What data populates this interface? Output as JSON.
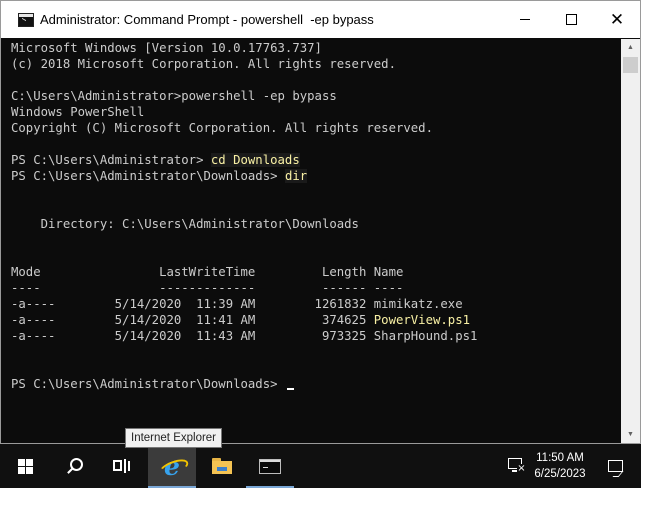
{
  "window": {
    "title": "Administrator: Command Prompt - powershell  -ep bypass",
    "minimize_label": "Minimize",
    "maximize_label": "Maximize",
    "close_label": "Close"
  },
  "console": {
    "lines": [
      {
        "text": "Microsoft Windows [Version 10.0.17763.737]"
      },
      {
        "text": "(c) 2018 Microsoft Corporation. All rights reserved."
      },
      {
        "text": ""
      },
      {
        "text": "C:\\Users\\Administrator>powershell -ep bypass"
      },
      {
        "text": "Windows PowerShell"
      },
      {
        "text": "Copyright (C) Microsoft Corporation. All rights reserved."
      },
      {
        "text": ""
      },
      {
        "prompt": "PS C:\\Users\\Administrator> ",
        "command": "cd Downloads"
      },
      {
        "prompt": "PS C:\\Users\\Administrator\\Downloads> ",
        "command": "dir"
      },
      {
        "text": ""
      },
      {
        "text": ""
      },
      {
        "text": "    Directory: C:\\Users\\Administrator\\Downloads"
      },
      {
        "text": ""
      },
      {
        "text": ""
      },
      {
        "text": "Mode                LastWriteTime         Length Name"
      },
      {
        "text": "----                -------------         ------ ----"
      },
      {
        "prefix": "-a----        5/14/2020  11:39 AM        1261832 ",
        "name": "mimikatz.exe",
        "name_color": "default"
      },
      {
        "prefix": "-a----        5/14/2020  11:41 AM         374625 ",
        "name": "PowerView.ps1",
        "name_color": "yellow"
      },
      {
        "prefix": "-a----        5/14/2020  11:43 AM         973325 ",
        "name": "SharpHound.ps1",
        "name_color": "default"
      },
      {
        "text": ""
      },
      {
        "text": ""
      },
      {
        "prompt": "PS C:\\Users\\Administrator\\Downloads> ",
        "cursor": true
      }
    ],
    "colors": {
      "background": "#0c0c0c",
      "text": "#cccccc",
      "highlight": "#f9f1a5"
    }
  },
  "tooltip": {
    "text": "Internet Explorer"
  },
  "taskbar": {
    "items": [
      {
        "icon": "windows-start-icon"
      },
      {
        "icon": "search-icon"
      },
      {
        "icon": "task-view-icon"
      },
      {
        "icon": "internet-explorer-icon"
      },
      {
        "icon": "file-explorer-icon"
      },
      {
        "icon": "command-prompt-icon"
      }
    ],
    "clock": {
      "time": "11:50 AM",
      "date": "6/25/2023"
    },
    "colors": {
      "background": "#101010",
      "accent": "#7aa7d6"
    }
  }
}
